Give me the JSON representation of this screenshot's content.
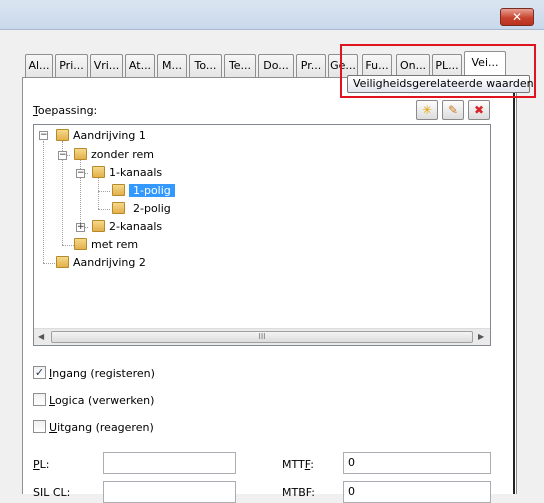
{
  "window": {
    "close_glyph": "✕"
  },
  "tabs": [
    {
      "label": "Al..."
    },
    {
      "label": "Pri..."
    },
    {
      "label": "Vri..."
    },
    {
      "label": "At..."
    },
    {
      "label": "M..."
    },
    {
      "label": "To..."
    },
    {
      "label": "Te..."
    },
    {
      "label": "Do..."
    },
    {
      "label": "Pr..."
    },
    {
      "label": "Ge..."
    },
    {
      "label": "Fu..."
    },
    {
      "label": "On..."
    },
    {
      "label": "PL..."
    },
    {
      "label": "Vei..."
    }
  ],
  "tooltip": "Veiligheidsgerelateerde waarden",
  "toepassing": {
    "label_first": "T",
    "label_rest": "oepassing:"
  },
  "toolbar": {
    "new_glyph": "✳",
    "edit_glyph": "✎",
    "delete_glyph": "✖"
  },
  "tree": {
    "nodes": [
      {
        "label": "Aandrijving 1",
        "expander": "−"
      },
      {
        "label": "zonder rem",
        "expander": "−"
      },
      {
        "label": "1-kanaals",
        "expander": "−"
      },
      {
        "label": "1-polig"
      },
      {
        "label": "2-polig"
      },
      {
        "label": "2-kanaals",
        "expander": "+"
      },
      {
        "label": "met rem"
      },
      {
        "label": "Aandrijving 2"
      }
    ],
    "scroll_left": "◀",
    "scroll_right": "▶",
    "scroll_grip": "III"
  },
  "checkboxes": [
    {
      "first": "I",
      "rest": "ngang (registeren)",
      "checked": true,
      "mark": "✓"
    },
    {
      "first": "L",
      "rest": "ogica (verwerken)",
      "checked": false,
      "mark": ""
    },
    {
      "first": "U",
      "rest": "itgang (reageren)",
      "checked": false,
      "mark": ""
    }
  ],
  "fields": {
    "pl_label_first": "P",
    "pl_label_rest": "L:",
    "pl_value": "",
    "mttf_label_first": "MTT",
    "mttf_label_u": "F",
    "mttf_label_rest": ":",
    "mttf_value": "0",
    "silcl_label": "SIL CL:",
    "silcl_value": "",
    "mtbf_label": "MTBF:",
    "mtbf_value": "0"
  }
}
